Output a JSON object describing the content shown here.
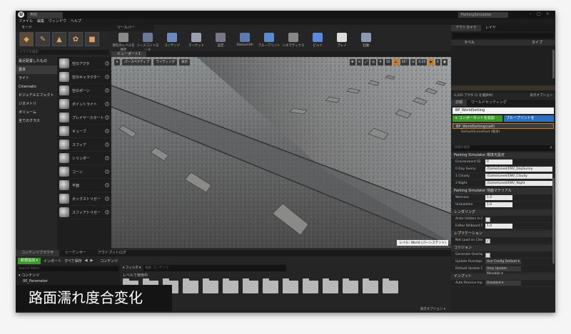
{
  "window": {
    "tab_title": "無題",
    "project_title": "ParkingSimulator",
    "logo": "U"
  },
  "menu": [
    "ファイル",
    "編集",
    "ウィンドウ",
    "ヘルプ"
  ],
  "modes": {
    "tab": "モード",
    "search_placeholder": "クラスを検索",
    "categories": [
      "最近配置したもの",
      "基本",
      "ライト",
      "Cinematic",
      "ビジュアルエフェクト",
      "ジオメトリ",
      "ボリューム",
      "全てのクラス"
    ],
    "selected_category": "基本",
    "items": [
      "空のアクタ",
      "空のキャラクター",
      "空のポーン",
      "ポイントライト",
      "プレイヤースタート",
      "キューブ",
      "スフィア",
      "シリンダー",
      "コーン",
      "平面",
      "ボックストリガー",
      "スフィアトリガー"
    ]
  },
  "toolbar": {
    "tab": "ツールバー",
    "buttons": [
      {
        "label": "現在のレベルを保存",
        "color": "#8a8a8a"
      },
      {
        "label": "ソースコントロール",
        "color": "#6a7a9a"
      },
      {
        "label": "コンテンツ",
        "color": "#6a8ac0"
      },
      {
        "label": "マーケット",
        "color": "#9aa0b0"
      },
      {
        "label": "設定",
        "color": "#777788"
      },
      {
        "label": "Datasmith",
        "color": "#5a7ab0"
      },
      {
        "label": "ブループリント",
        "color": "#5a8ad0"
      },
      {
        "label": "シネマティクス",
        "color": "#888888"
      },
      {
        "label": "ビルド",
        "color": "#5a8ae0"
      },
      {
        "label": "プレイ",
        "color": "#dddddd"
      },
      {
        "label": "起動",
        "color": "#8a9ab0"
      }
    ]
  },
  "viewport": {
    "tab": "ビューポート1",
    "perspective": "パースペクティブ",
    "lighting": "ライティング",
    "show": "表示",
    "snap_angle": "10",
    "rot_angle": "45°",
    "scale": "0.25",
    "cam_speed": "4",
    "level_label": "レベル: World (パーシステント)"
  },
  "outliner": {
    "tabs": [
      "アウトライナ",
      "レイヤ"
    ],
    "col_label": "ラベル",
    "col_type": "タイプ",
    "rows": 10,
    "footer_count": "2,245 アクタ (1 を選択中)",
    "footer_view": "表示オプション"
  },
  "details": {
    "tabs": [
      "詳細",
      "ワールドセッティング"
    ],
    "object_name": "BP_WorldSetting",
    "add_component": "+ コンポーネントを追加",
    "blueprint": "ブループリントを",
    "component_self": "BP_WorldSetting(self)",
    "component_root": "DefaultSceneRoot (継承)",
    "search_placeholder": "詳細の検索",
    "sections": [
      {
        "title": "Parking Simulator 環境光設定",
        "rows": [
          {
            "key": "Environment ID",
            "value": "0",
            "kind": "num"
          },
          {
            "key": "0 Day Sunny",
            "value": "/Game/Level/ENV_DaySunny",
            "kind": "text"
          },
          {
            "key": "1 Cloudy",
            "value": "/Game/Level/ENV_Cloudy",
            "kind": "text"
          },
          {
            "key": "2 Night",
            "value": "/Game/Level/ENV_Night",
            "kind": "text"
          }
        ]
      },
      {
        "title": "Parking Simulator 地面マテリアル",
        "rows": [
          {
            "key": "Wetness",
            "value": "1.0",
            "kind": "num"
          },
          {
            "key": "Undulation",
            "value": "1.0",
            "kind": "num"
          }
        ]
      },
      {
        "title": "レンダリング",
        "rows": [
          {
            "key": "Actor Hidden In Game",
            "value": "",
            "kind": "check"
          },
          {
            "key": "Editor Billboard Scale",
            "value": "1.0",
            "kind": "num"
          }
        ]
      },
      {
        "title": "レプリケーション",
        "rows": [
          {
            "key": "Net Load on Client",
            "value": "✓",
            "kind": "check"
          }
        ]
      },
      {
        "title": "コリジョン",
        "rows": [
          {
            "key": "Generate Overlap Events",
            "value": "",
            "kind": "check"
          },
          {
            "key": "Update Overlaps Method",
            "value": "Use Config Default ▾",
            "kind": "dd"
          },
          {
            "key": "Default Update Overlaps",
            "value": "Only Update Movable ▾",
            "kind": "dd"
          }
        ]
      },
      {
        "title": "インプット",
        "rows": [
          {
            "key": "Auto Receive Input",
            "value": "Disabled ▾",
            "kind": "dd"
          }
        ]
      }
    ]
  },
  "content_browser": {
    "tabs": [
      "コンテンツブラウザ",
      "シーケンサー",
      "アウトプットログ"
    ],
    "new_add": "新規追加 ▾",
    "import": "インポート",
    "save_all": "すべて保存",
    "path": "コンテンツ",
    "left_search_placeholder": "Search Paths",
    "tree": [
      "▾ コンテンツ",
      "00_Parameter"
    ],
    "filter": "▾ フィルタ ▾",
    "filter_placeholder": "検索 コンテンツ",
    "recent": "レベルで使用中",
    "folder_count": 14,
    "view_options": "表示オプション ▾"
  },
  "subtitle": "路面濡れ度合変化"
}
